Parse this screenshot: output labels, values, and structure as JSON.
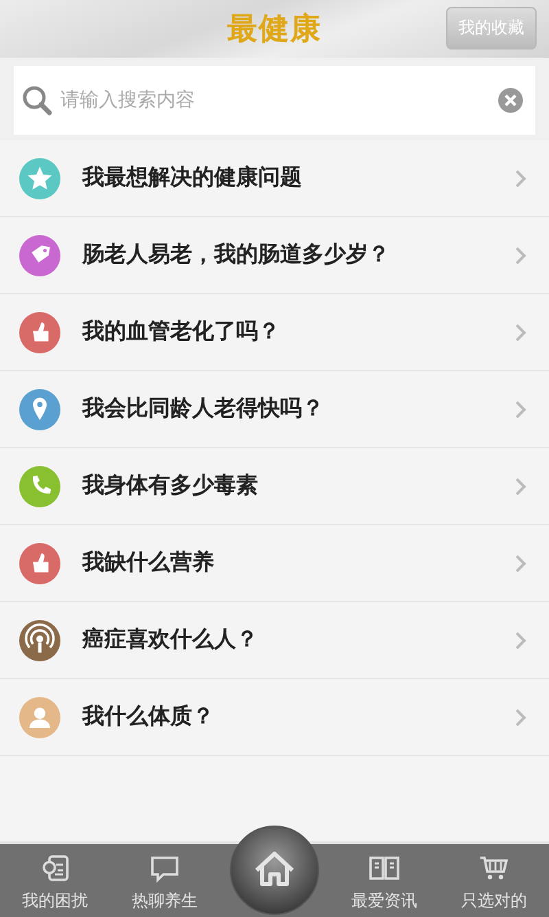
{
  "header": {
    "title": "最健康",
    "favorites_button": "我的收藏"
  },
  "search": {
    "placeholder": "请输入搜索内容"
  },
  "items": [
    {
      "label": "我最想解决的健康问题",
      "kind": "star",
      "color": "#5cc8c4"
    },
    {
      "label": "肠老人易老，我的肠道多少岁？",
      "kind": "tag",
      "color": "#c868d0"
    },
    {
      "label": "我的血管老化了吗？",
      "kind": "thumb",
      "color": "#d86a68"
    },
    {
      "label": "我会比同龄人老得快吗？",
      "kind": "pin",
      "color": "#5aa0d0"
    },
    {
      "label": "我身体有多少毒素",
      "kind": "phone",
      "color": "#88c030"
    },
    {
      "label": "我缺什么营养",
      "kind": "thumb",
      "color": "#d86a68"
    },
    {
      "label": "癌症喜欢什么人？",
      "kind": "signal",
      "color": "#8a6a48"
    },
    {
      "label": "我什么体质？",
      "kind": "person",
      "color": "#e4b888"
    }
  ],
  "tabbar": [
    {
      "label": "我的困扰",
      "kind": "doc"
    },
    {
      "label": "热聊养生",
      "kind": "chat"
    },
    {
      "kind": "home"
    },
    {
      "label": "最爱资讯",
      "kind": "book"
    },
    {
      "label": "只选对的",
      "kind": "cart"
    }
  ]
}
